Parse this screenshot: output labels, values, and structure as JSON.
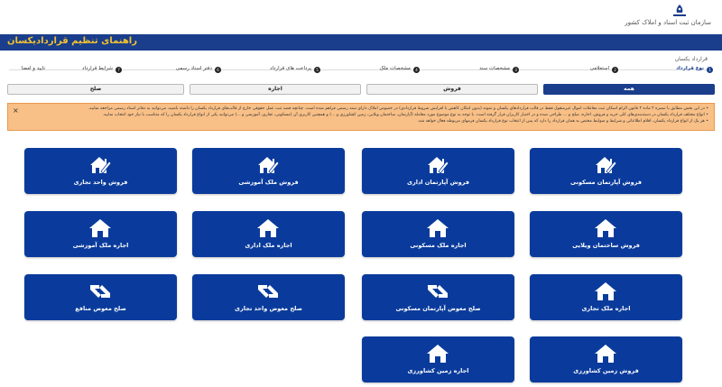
{
  "header": {
    "logo_caption": "سازمان ثبت اسناد و املاک کشور",
    "page_title": "راهنمای تنظیم قراردادیکسان",
    "breadcrumb": "قرارداد یکسان"
  },
  "steps": [
    {
      "number": "1",
      "label": "نوع قرارداد",
      "active": true
    },
    {
      "number": "2",
      "label": "استعلامی"
    },
    {
      "number": "3",
      "label": "مشخصات سند"
    },
    {
      "number": "4",
      "label": "مشخصات ملک"
    },
    {
      "number": "5",
      "label": "پرداخت های قرارداد"
    },
    {
      "number": "6",
      "label": "دفتر اسناد رسمی"
    },
    {
      "number": "7",
      "label": "شرایط قرارداد"
    },
    {
      "number": "",
      "label": "تایید و امضا"
    }
  ],
  "tabs": [
    {
      "label": "همه",
      "active": true
    },
    {
      "label": "فروش"
    },
    {
      "label": "اجاره"
    },
    {
      "label": "صلح"
    }
  ],
  "notice": {
    "close": "×",
    "lines": [
      "• در این بخش مطابق با تبصره ۲ ماده ۲ قانون الزام اسکان ثبت معاملات اموال غیرمنقول فقط در قالب قراردادهای یکسان و نمونه (بدون امکان کاهش یا افزایش شروط قراردادی) در خصوص املاک دارای سند رسمی فراهم شده است. چنانچه قصد ثبت عمل حقوقی خارج از قالب‌های قرارداد یکسان را داشته باشید، می‌توانید به دفاتر اسناد رسمی مراجعه نمایید.",
      "• انواع مختلف قرارداد یکسان در دسته‌بندی‌های کلی خرید و فروش، اجاره، صلح و ... طراحی شده و در اختیار کاربران قرار گرفته است. با توجه به نوع موضوع مورد معامله (آپارتمان، ساختمان ویلایی، زمین کشاورزی و ...) و همچنین کاربری آن (مسکونی، تجاری، آموزشی و ...) می‌توانید یکی از انواع قرارداد یکسان را که متناسب با نیاز خود انتخاب نمایید.",
      "• هر یک از انواع قرارداد یکسان، اقلام اطلاعاتی و شرایط و ضوابط مختص به همان قرارداد را دارد که پس از انتخاب نوع قرارداد یکسان فرمهای مربوطه فعال خواهد شد."
    ]
  },
  "cards": [
    {
      "label": "فروش آپارتمان مسکونی",
      "icon": "house-pen-icon"
    },
    {
      "label": "فروش آپارتمان اداری",
      "icon": "house-pen-icon"
    },
    {
      "label": "فروش ملک آموزشی",
      "icon": "house-pen-icon"
    },
    {
      "label": "فروش واحد تجاری",
      "icon": "house-pen-icon"
    },
    {
      "label": "فروش ساختمان ویلایی",
      "icon": "house-icon"
    },
    {
      "label": "اجاره ملک مسکونی",
      "icon": "house-icon"
    },
    {
      "label": "اجاره ملک اداری",
      "icon": "house-icon"
    },
    {
      "label": "اجاره ملک آموزشی",
      "icon": "house-icon"
    },
    {
      "label": "اجاره ملک تجاری",
      "icon": "house-icon"
    },
    {
      "label": "صلح معوض آپارتمان مسکونی",
      "icon": "handshake-icon"
    },
    {
      "label": "صلح معوض واحد تجاری",
      "icon": "handshake-icon"
    },
    {
      "label": "صلح معوض منافع",
      "icon": "handshake-icon"
    },
    {
      "label": "فروش زمین کشاورزی",
      "icon": "house-icon"
    },
    {
      "label": "اجاره زمین کشاورزی",
      "icon": "house-icon"
    }
  ],
  "colors": {
    "primary": "#0a3b9c",
    "title_text": "#f2c230",
    "notice_bg": "#f8bf86"
  }
}
